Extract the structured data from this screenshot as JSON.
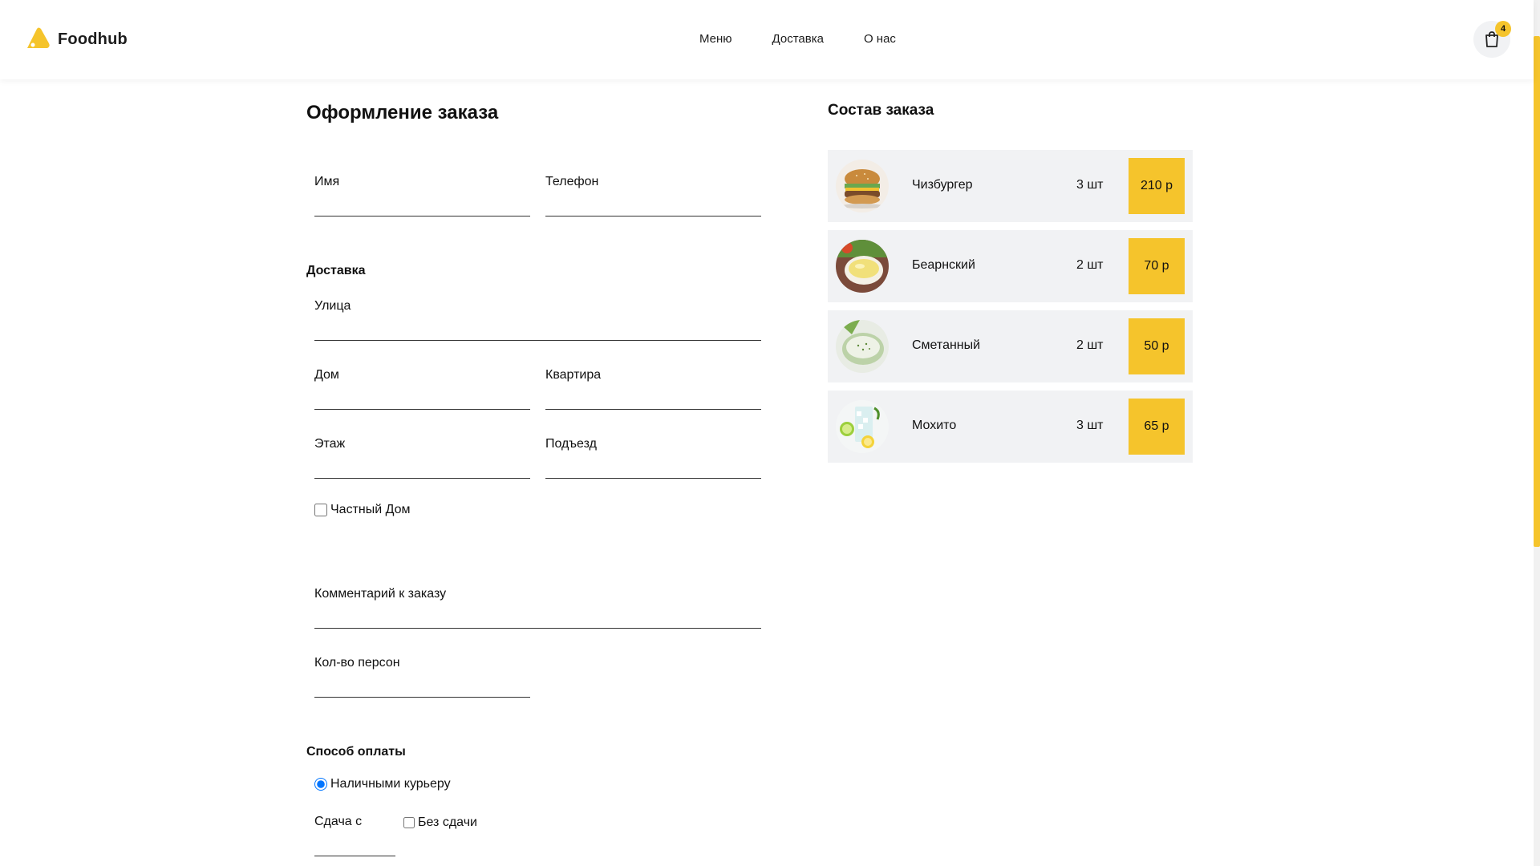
{
  "header": {
    "brand": "Foodhub",
    "nav": [
      "Меню",
      "Доставка",
      "О нас"
    ],
    "cart_count": "4"
  },
  "form": {
    "title": "Оформление заказа",
    "name_label": "Имя",
    "phone_label": "Телефон",
    "delivery_section": "Доставка",
    "street_label": "Улица",
    "house_label": "Дом",
    "apartment_label": "Квартира",
    "floor_label": "Этаж",
    "entrance_label": "Подъезд",
    "private_house_label": "Частный Дом",
    "comment_label": "Комментарий к заказу",
    "persons_label": "Кол-во персон",
    "payment_section": "Способ оплаты",
    "cash_label": "Наличными курьеру",
    "change_label": "Сдача с",
    "no_change_label": "Без сдачи"
  },
  "order": {
    "title": "Состав заказа",
    "items": [
      {
        "name": "Чизбургер",
        "qty": "3 шт",
        "price": "210 р",
        "icon": "cheeseburger-image"
      },
      {
        "name": "Беарнский",
        "qty": "2 шт",
        "price": "70 р",
        "icon": "bearnaise-sauce-image"
      },
      {
        "name": "Сметанный",
        "qty": "2 шт",
        "price": "50 р",
        "icon": "sour-cream-sauce-image"
      },
      {
        "name": "Мохито",
        "qty": "3 шт",
        "price": "65 р",
        "icon": "mojito-image"
      }
    ]
  },
  "colors": {
    "accent": "#f5c42c",
    "item_bg": "#f1f2f4",
    "text": "#111111"
  }
}
